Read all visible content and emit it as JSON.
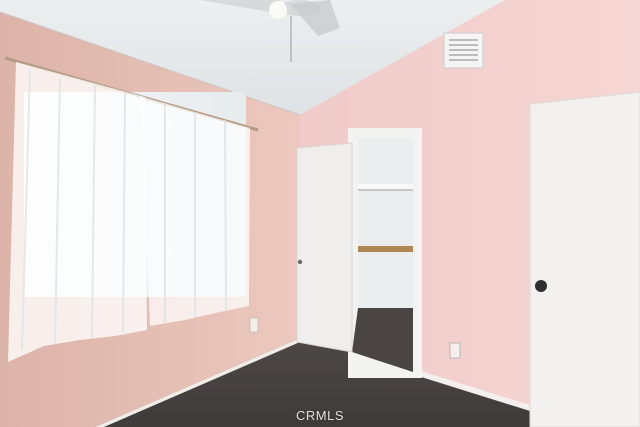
{
  "watermark": "CRMLS"
}
